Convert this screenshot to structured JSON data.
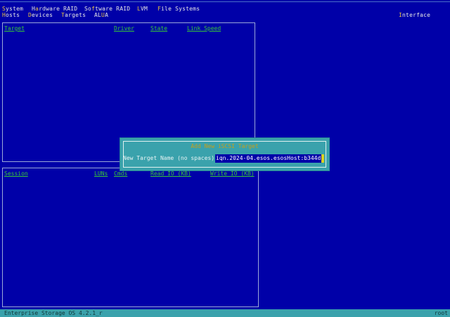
{
  "menu": {
    "row1": [
      {
        "hot": "S",
        "rest": "ystem"
      },
      {
        "hot": "",
        "pre": "H",
        "hot2": "a",
        "rest": "rdware RAID"
      },
      {
        "pre": "So",
        "hot": "f",
        "rest": "tware RAID"
      },
      {
        "hot": "L",
        "rest": "VM"
      },
      {
        "hot": "F",
        "rest": "ile Systems"
      }
    ],
    "row2": [
      {
        "hot": "H",
        "rest": "osts"
      },
      {
        "hot": "D",
        "rest": "evices"
      },
      {
        "hot": "T",
        "rest": "argets"
      },
      {
        "pre": "AL",
        "hot": "U",
        "rest": "A"
      }
    ],
    "interface": {
      "hot": "I",
      "rest": "nterface"
    }
  },
  "targets_panel": {
    "columns": [
      "Target",
      "Driver",
      "State",
      "Link Speed"
    ]
  },
  "sessions_panel": {
    "columns": [
      "Session",
      "LUNs",
      "Cmds",
      "Read IO (KB)",
      "Write IO (KB)"
    ]
  },
  "dialog": {
    "title": "Add New iSCSI Target",
    "label": "New Target Name (no spaces):",
    "value": "iqn.2024-04.esos.esosHost:b344d"
  },
  "status": {
    "left": "Enterprise Storage OS 4.2.1_r",
    "right": "root"
  },
  "colors": {
    "background": "#0000a8",
    "dialog": "#3aa2ac",
    "header_green": "#38c838",
    "hotkey": "#e8c040"
  }
}
